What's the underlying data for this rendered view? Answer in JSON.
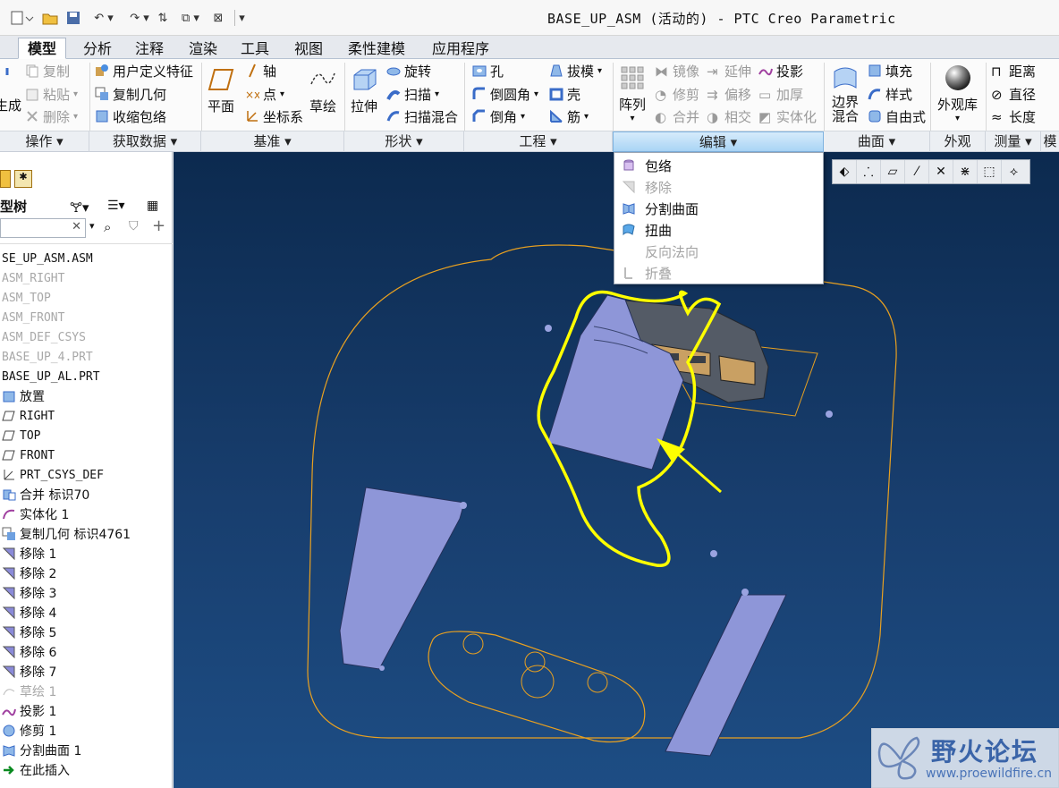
{
  "window": {
    "title": "BASE_UP_ASM (活动的) - PTC Creo Parametric"
  },
  "tabs": [
    {
      "label": "模型",
      "active": true
    },
    {
      "label": "分析"
    },
    {
      "label": "注释"
    },
    {
      "label": "渲染"
    },
    {
      "label": "工具"
    },
    {
      "label": "视图"
    },
    {
      "label": "柔性建模"
    },
    {
      "label": "应用程序"
    }
  ],
  "ribbon": {
    "operation": {
      "regen": "生成",
      "copy": "复制",
      "paste": "粘贴",
      "delete": "删除"
    },
    "getdata": {
      "udf": "用户定义特征",
      "copygeom": "复制几何",
      "shrinkwrap": "收缩包络"
    },
    "datum": {
      "plane": "平面",
      "axis": "轴",
      "point": "点",
      "csys": "坐标系",
      "sketch": "草绘"
    },
    "shapes": {
      "extrude": "拉伸",
      "revolve": "旋转",
      "sweep": "扫描",
      "sweepblend": "扫描混合"
    },
    "engineering": {
      "hole": "孔",
      "round": "倒圆角",
      "chamfer": "倒角",
      "draft": "拔模",
      "shell": "壳",
      "rib": "筋"
    },
    "editing": {
      "pattern": "阵列",
      "mirror": "镜像",
      "trim": "修剪",
      "merge": "合并",
      "extend": "延伸",
      "offset": "偏移",
      "intersect": "相交",
      "project": "投影",
      "thicken": "加厚",
      "solidify": "实体化"
    },
    "surfaces": {
      "boundary": "边界混合",
      "fill": "填充",
      "style": "样式",
      "freestyle": "自由式"
    },
    "model_display": {
      "appearance": "外观库"
    },
    "measure": {
      "distance": "距离",
      "diameter": "直径",
      "length": "长度"
    }
  },
  "groups": [
    {
      "label": "操作"
    },
    {
      "label": "获取数据"
    },
    {
      "label": "基准"
    },
    {
      "label": "形状"
    },
    {
      "label": "工程"
    },
    {
      "label": "编辑",
      "active": true
    },
    {
      "label": "曲面"
    },
    {
      "label": "外观"
    },
    {
      "label": "测量"
    },
    {
      "label": "模"
    }
  ],
  "edit_menu": [
    {
      "label": "包络",
      "icon": "wrap-icon",
      "enabled": true
    },
    {
      "label": "移除",
      "icon": "remove-icon",
      "enabled": false
    },
    {
      "label": "分割曲面",
      "icon": "split-surface-icon",
      "enabled": true
    },
    {
      "label": "扭曲",
      "icon": "warp-icon",
      "enabled": true
    },
    {
      "label": "反向法向",
      "icon": "flip-normal-icon",
      "enabled": false
    },
    {
      "label": "折叠",
      "icon": "fold-icon",
      "enabled": false
    }
  ],
  "model_tree": {
    "header": "型树",
    "items": [
      {
        "label": "SE_UP_ASM.ASM",
        "mono": true
      },
      {
        "label": "ASM_RIGHT",
        "mono": true,
        "dim": true
      },
      {
        "label": "ASM_TOP",
        "mono": true,
        "dim": true
      },
      {
        "label": "ASM_FRONT",
        "mono": true,
        "dim": true
      },
      {
        "label": "ASM_DEF_CSYS",
        "mono": true,
        "dim": true
      },
      {
        "label": "BASE_UP_4.PRT",
        "mono": true,
        "dim": true
      },
      {
        "label": "BASE_UP_AL.PRT",
        "mono": true
      },
      {
        "label": "放置",
        "icon": "placement-icon"
      },
      {
        "label": "RIGHT",
        "icon": "datum-plane-icon",
        "mono": true
      },
      {
        "label": "TOP",
        "icon": "datum-plane-icon",
        "mono": true
      },
      {
        "label": "FRONT",
        "icon": "datum-plane-icon",
        "mono": true
      },
      {
        "label": "PRT_CSYS_DEF",
        "icon": "csys-icon",
        "mono": true
      },
      {
        "label": "合并 标识70",
        "icon": "merge-icon"
      },
      {
        "label": "实体化 1",
        "icon": "solidify-icon"
      },
      {
        "label": "复制几何 标识4761",
        "icon": "copy-geom-icon"
      },
      {
        "label": "移除 1",
        "icon": "remove-icon"
      },
      {
        "label": "移除 2",
        "icon": "remove-icon"
      },
      {
        "label": "移除 3",
        "icon": "remove-icon"
      },
      {
        "label": "移除 4",
        "icon": "remove-icon"
      },
      {
        "label": "移除 5",
        "icon": "remove-icon"
      },
      {
        "label": "移除 6",
        "icon": "remove-icon"
      },
      {
        "label": "移除 7",
        "icon": "remove-icon"
      },
      {
        "label": "草绘 1",
        "icon": "sketch-icon",
        "dim": true
      },
      {
        "label": "投影 1",
        "icon": "project-icon"
      },
      {
        "label": "修剪 1",
        "icon": "trim-icon"
      },
      {
        "label": "分割曲面 1",
        "icon": "split-surface-icon"
      },
      {
        "label": "在此插入",
        "icon": "insert-arrow-icon"
      }
    ]
  },
  "watermark": {
    "name": "野火论坛",
    "url": "www.proewildfire.cn"
  },
  "colors": {
    "viewport_top": "#0c2a4f",
    "viewport_bottom": "#1d4d84",
    "surface": "#8e96d8",
    "edge": "#e8a020",
    "annotation": "#ffff00",
    "selected_group": "#a9d4f5"
  }
}
